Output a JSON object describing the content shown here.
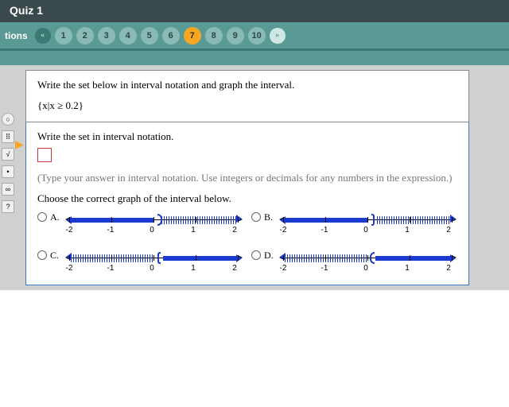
{
  "header": {
    "title": "Quiz 1"
  },
  "nav": {
    "label": "tions",
    "prev": "«",
    "next": "»",
    "items": [
      "1",
      "2",
      "3",
      "4",
      "5",
      "6",
      "7",
      "8",
      "9",
      "10"
    ],
    "current": "7"
  },
  "toolbar": {
    "t1": "○",
    "t2": "⠿",
    "t3": "√",
    "t4": "•",
    "t5": "∞",
    "t6": "?"
  },
  "question": {
    "prompt": "Write the set below in interval notation and graph the interval.",
    "set": "{x|x ≥ 0.2}"
  },
  "answer": {
    "subprompt": "Write the set in interval notation.",
    "hint": "(Type your answer in interval notation. Use integers or decimals for any numbers in the expression.)",
    "graphprompt": "Choose the correct graph of the interval below."
  },
  "choices": {
    "a": "A.",
    "b": "B.",
    "c": "C.",
    "d": "D."
  },
  "ticks": {
    "m2": "-2",
    "m1": "-1",
    "z": "0",
    "p1": "1",
    "p2": "2"
  }
}
